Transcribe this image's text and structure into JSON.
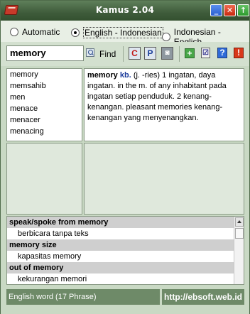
{
  "window": {
    "title": "Kamus 2.04"
  },
  "titlebar_buttons": [
    {
      "name": "minimize-button",
      "glyph": "_"
    },
    {
      "name": "close-button",
      "glyph": "✕"
    },
    {
      "name": "maximize-button",
      "glyph": "↑"
    }
  ],
  "direction": {
    "options": [
      {
        "label": "Automatic",
        "checked": false
      },
      {
        "label": "English - Indonesian",
        "checked": true
      },
      {
        "label": "Indonesian - English",
        "checked": false
      }
    ]
  },
  "search": {
    "value": "memory",
    "find_label": "Find"
  },
  "toolbar": {
    "c_label": "C",
    "p_label": "P",
    "camera_glyph": "◙",
    "add_glyph": "+",
    "check_glyph": "☑",
    "help_glyph": "?",
    "warn_glyph": "!"
  },
  "word_list": [
    "memory",
    "memsahib",
    "men",
    "menace",
    "menacer",
    "menacing"
  ],
  "definition": {
    "head": "memory",
    "pos": "kb.",
    "text": "(j. -ries) 1 ingatan, daya ingatan. in the m. of any inhabitant pada ingatan setiap penduduk. 2 kenang-kenangan. pleasant memories kenang-kenangan yang menyenangkan."
  },
  "phrases": [
    {
      "phrase": "speak/spoke from memory",
      "meaning": "berbicara tanpa teks"
    },
    {
      "phrase": "memory size",
      "meaning": "kapasitas memory"
    },
    {
      "phrase": "out of memory",
      "meaning": "kekurangan memori"
    }
  ],
  "status": {
    "left": "English word (17 Phrase)",
    "right": "http://ebsoft.web.id"
  }
}
